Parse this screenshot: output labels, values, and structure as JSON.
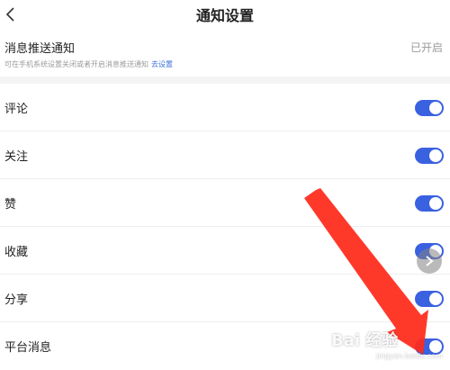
{
  "header": {
    "title": "通知设置",
    "back_icon": "chevron-left-icon"
  },
  "push": {
    "title": "消息推送通知",
    "status": "已开启",
    "hint": "可在手机系统设置关闭或者开启消息推送通知",
    "link": "去设置"
  },
  "rows": [
    {
      "label": "评论",
      "enabled": true
    },
    {
      "label": "关注",
      "enabled": true
    },
    {
      "label": "赞",
      "enabled": true
    },
    {
      "label": "收藏",
      "enabled": true
    },
    {
      "label": "分享",
      "enabled": true
    },
    {
      "label": "平台消息",
      "enabled": true
    }
  ],
  "watermark": {
    "text": "Bai 经验",
    "sub": "jingyan.baidu.com"
  },
  "colors": {
    "toggle_on": "#3a61e0",
    "link": "#3b6fd8",
    "annotation_arrow": "#ff2a1a"
  }
}
